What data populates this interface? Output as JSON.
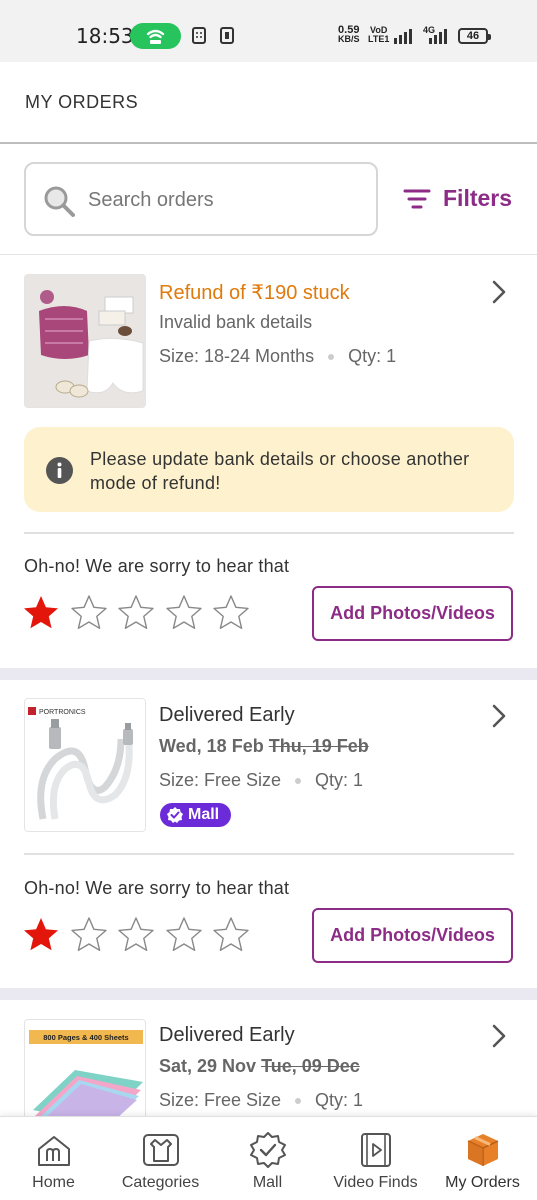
{
  "status_bar": {
    "time": "18:53",
    "net_speed_value": "0.59",
    "net_speed_unit": "KB/S",
    "volte_top": "VoD",
    "volte_bottom": "LTE1",
    "network_type": "4G",
    "battery": "46"
  },
  "header": {
    "title": "MY ORDERS"
  },
  "search": {
    "placeholder": "Search orders",
    "filters_label": "Filters"
  },
  "orders": [
    {
      "status": "Refund of ₹190 stuck",
      "status_color": "#e07a0c",
      "substatus": "Invalid bank details",
      "size": "Size: 18-24 Months",
      "qty": "Qty: 1",
      "alert_text": "Please update bank details or choose another mode of refund!",
      "rating_prompt": "Oh-no! We are sorry to hear that",
      "rating": 1,
      "button": "Add Photos/Videos"
    },
    {
      "status": "Delivered Early",
      "date": "Wed, 18 Feb",
      "original_date": "Thu, 19 Feb",
      "size": "Size: Free Size",
      "qty": "Qty: 1",
      "badge": "Mall",
      "brand_text": "PORTRONICS",
      "rating_prompt": "Oh-no! We are sorry to hear that",
      "rating": 1,
      "button": "Add Photos/Videos"
    },
    {
      "status": "Delivered Early",
      "date": "Sat, 29 Nov",
      "original_date": "Tue, 09 Dec",
      "size": "Size: Free Size",
      "qty": "Qty: 1",
      "product_tag": "800 Pages & 400 Sheets"
    }
  ],
  "bottom_nav": [
    {
      "label": "Home",
      "icon": "home-icon"
    },
    {
      "label": "Categories",
      "icon": "categories-icon"
    },
    {
      "label": "Mall",
      "icon": "mall-icon"
    },
    {
      "label": "Video Finds",
      "icon": "video-icon"
    },
    {
      "label": "My Orders",
      "icon": "orders-box-icon",
      "active": true
    }
  ],
  "colors": {
    "brand": "#8c2c86",
    "refund_orange": "#e07a0c",
    "alert_bg": "#fdf2cd",
    "star_filled": "#e3160b",
    "mall_badge": "#6c2bd9",
    "hotspot_green": "#27c35d"
  }
}
